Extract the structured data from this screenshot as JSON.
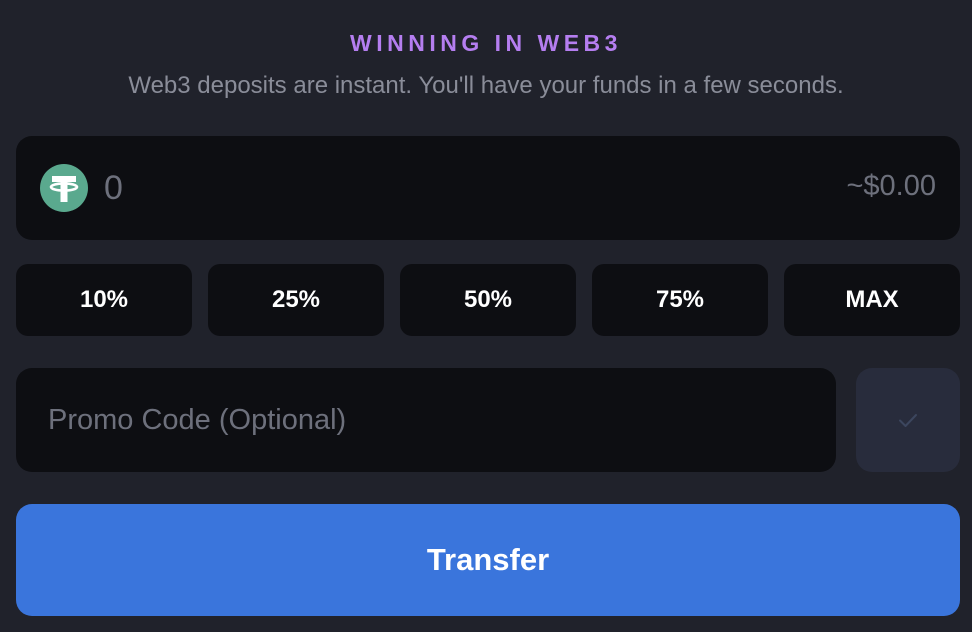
{
  "header": {
    "headline": "WINNING IN WEB3",
    "subtitle": "Web3 deposits are instant. You'll have your funds in a few seconds."
  },
  "amount": {
    "token_icon": "tether-usdt-icon",
    "placeholder": "0",
    "usd_value": "~$0.00"
  },
  "percent_buttons": [
    {
      "label": "10%"
    },
    {
      "label": "25%"
    },
    {
      "label": "50%"
    },
    {
      "label": "75%"
    },
    {
      "label": "MAX"
    }
  ],
  "promo": {
    "placeholder": "Promo Code (Optional)",
    "apply_icon": "checkmark-icon"
  },
  "transfer": {
    "label": "Transfer"
  },
  "colors": {
    "background": "#20222b",
    "panel": "#0d0e12",
    "accent_purple": "#b57ef0",
    "primary_blue": "#3a75dc",
    "tether_green": "#5aa98e"
  }
}
